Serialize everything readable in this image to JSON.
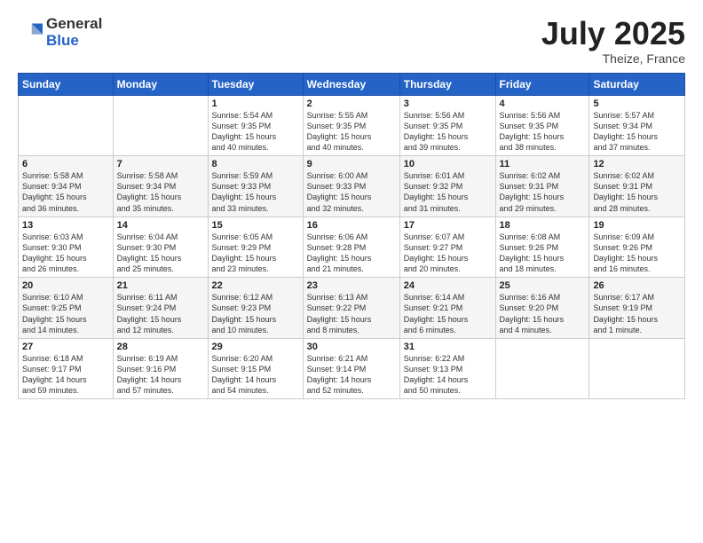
{
  "logo": {
    "general": "General",
    "blue": "Blue"
  },
  "title": "July 2025",
  "subtitle": "Theize, France",
  "days_header": [
    "Sunday",
    "Monday",
    "Tuesday",
    "Wednesday",
    "Thursday",
    "Friday",
    "Saturday"
  ],
  "weeks": [
    [
      {
        "day": "",
        "info": ""
      },
      {
        "day": "",
        "info": ""
      },
      {
        "day": "1",
        "info": "Sunrise: 5:54 AM\nSunset: 9:35 PM\nDaylight: 15 hours\nand 40 minutes."
      },
      {
        "day": "2",
        "info": "Sunrise: 5:55 AM\nSunset: 9:35 PM\nDaylight: 15 hours\nand 40 minutes."
      },
      {
        "day": "3",
        "info": "Sunrise: 5:56 AM\nSunset: 9:35 PM\nDaylight: 15 hours\nand 39 minutes."
      },
      {
        "day": "4",
        "info": "Sunrise: 5:56 AM\nSunset: 9:35 PM\nDaylight: 15 hours\nand 38 minutes."
      },
      {
        "day": "5",
        "info": "Sunrise: 5:57 AM\nSunset: 9:34 PM\nDaylight: 15 hours\nand 37 minutes."
      }
    ],
    [
      {
        "day": "6",
        "info": "Sunrise: 5:58 AM\nSunset: 9:34 PM\nDaylight: 15 hours\nand 36 minutes."
      },
      {
        "day": "7",
        "info": "Sunrise: 5:58 AM\nSunset: 9:34 PM\nDaylight: 15 hours\nand 35 minutes."
      },
      {
        "day": "8",
        "info": "Sunrise: 5:59 AM\nSunset: 9:33 PM\nDaylight: 15 hours\nand 33 minutes."
      },
      {
        "day": "9",
        "info": "Sunrise: 6:00 AM\nSunset: 9:33 PM\nDaylight: 15 hours\nand 32 minutes."
      },
      {
        "day": "10",
        "info": "Sunrise: 6:01 AM\nSunset: 9:32 PM\nDaylight: 15 hours\nand 31 minutes."
      },
      {
        "day": "11",
        "info": "Sunrise: 6:02 AM\nSunset: 9:31 PM\nDaylight: 15 hours\nand 29 minutes."
      },
      {
        "day": "12",
        "info": "Sunrise: 6:02 AM\nSunset: 9:31 PM\nDaylight: 15 hours\nand 28 minutes."
      }
    ],
    [
      {
        "day": "13",
        "info": "Sunrise: 6:03 AM\nSunset: 9:30 PM\nDaylight: 15 hours\nand 26 minutes."
      },
      {
        "day": "14",
        "info": "Sunrise: 6:04 AM\nSunset: 9:30 PM\nDaylight: 15 hours\nand 25 minutes."
      },
      {
        "day": "15",
        "info": "Sunrise: 6:05 AM\nSunset: 9:29 PM\nDaylight: 15 hours\nand 23 minutes."
      },
      {
        "day": "16",
        "info": "Sunrise: 6:06 AM\nSunset: 9:28 PM\nDaylight: 15 hours\nand 21 minutes."
      },
      {
        "day": "17",
        "info": "Sunrise: 6:07 AM\nSunset: 9:27 PM\nDaylight: 15 hours\nand 20 minutes."
      },
      {
        "day": "18",
        "info": "Sunrise: 6:08 AM\nSunset: 9:26 PM\nDaylight: 15 hours\nand 18 minutes."
      },
      {
        "day": "19",
        "info": "Sunrise: 6:09 AM\nSunset: 9:26 PM\nDaylight: 15 hours\nand 16 minutes."
      }
    ],
    [
      {
        "day": "20",
        "info": "Sunrise: 6:10 AM\nSunset: 9:25 PM\nDaylight: 15 hours\nand 14 minutes."
      },
      {
        "day": "21",
        "info": "Sunrise: 6:11 AM\nSunset: 9:24 PM\nDaylight: 15 hours\nand 12 minutes."
      },
      {
        "day": "22",
        "info": "Sunrise: 6:12 AM\nSunset: 9:23 PM\nDaylight: 15 hours\nand 10 minutes."
      },
      {
        "day": "23",
        "info": "Sunrise: 6:13 AM\nSunset: 9:22 PM\nDaylight: 15 hours\nand 8 minutes."
      },
      {
        "day": "24",
        "info": "Sunrise: 6:14 AM\nSunset: 9:21 PM\nDaylight: 15 hours\nand 6 minutes."
      },
      {
        "day": "25",
        "info": "Sunrise: 6:16 AM\nSunset: 9:20 PM\nDaylight: 15 hours\nand 4 minutes."
      },
      {
        "day": "26",
        "info": "Sunrise: 6:17 AM\nSunset: 9:19 PM\nDaylight: 15 hours\nand 1 minute."
      }
    ],
    [
      {
        "day": "27",
        "info": "Sunrise: 6:18 AM\nSunset: 9:17 PM\nDaylight: 14 hours\nand 59 minutes."
      },
      {
        "day": "28",
        "info": "Sunrise: 6:19 AM\nSunset: 9:16 PM\nDaylight: 14 hours\nand 57 minutes."
      },
      {
        "day": "29",
        "info": "Sunrise: 6:20 AM\nSunset: 9:15 PM\nDaylight: 14 hours\nand 54 minutes."
      },
      {
        "day": "30",
        "info": "Sunrise: 6:21 AM\nSunset: 9:14 PM\nDaylight: 14 hours\nand 52 minutes."
      },
      {
        "day": "31",
        "info": "Sunrise: 6:22 AM\nSunset: 9:13 PM\nDaylight: 14 hours\nand 50 minutes."
      },
      {
        "day": "",
        "info": ""
      },
      {
        "day": "",
        "info": ""
      }
    ]
  ]
}
